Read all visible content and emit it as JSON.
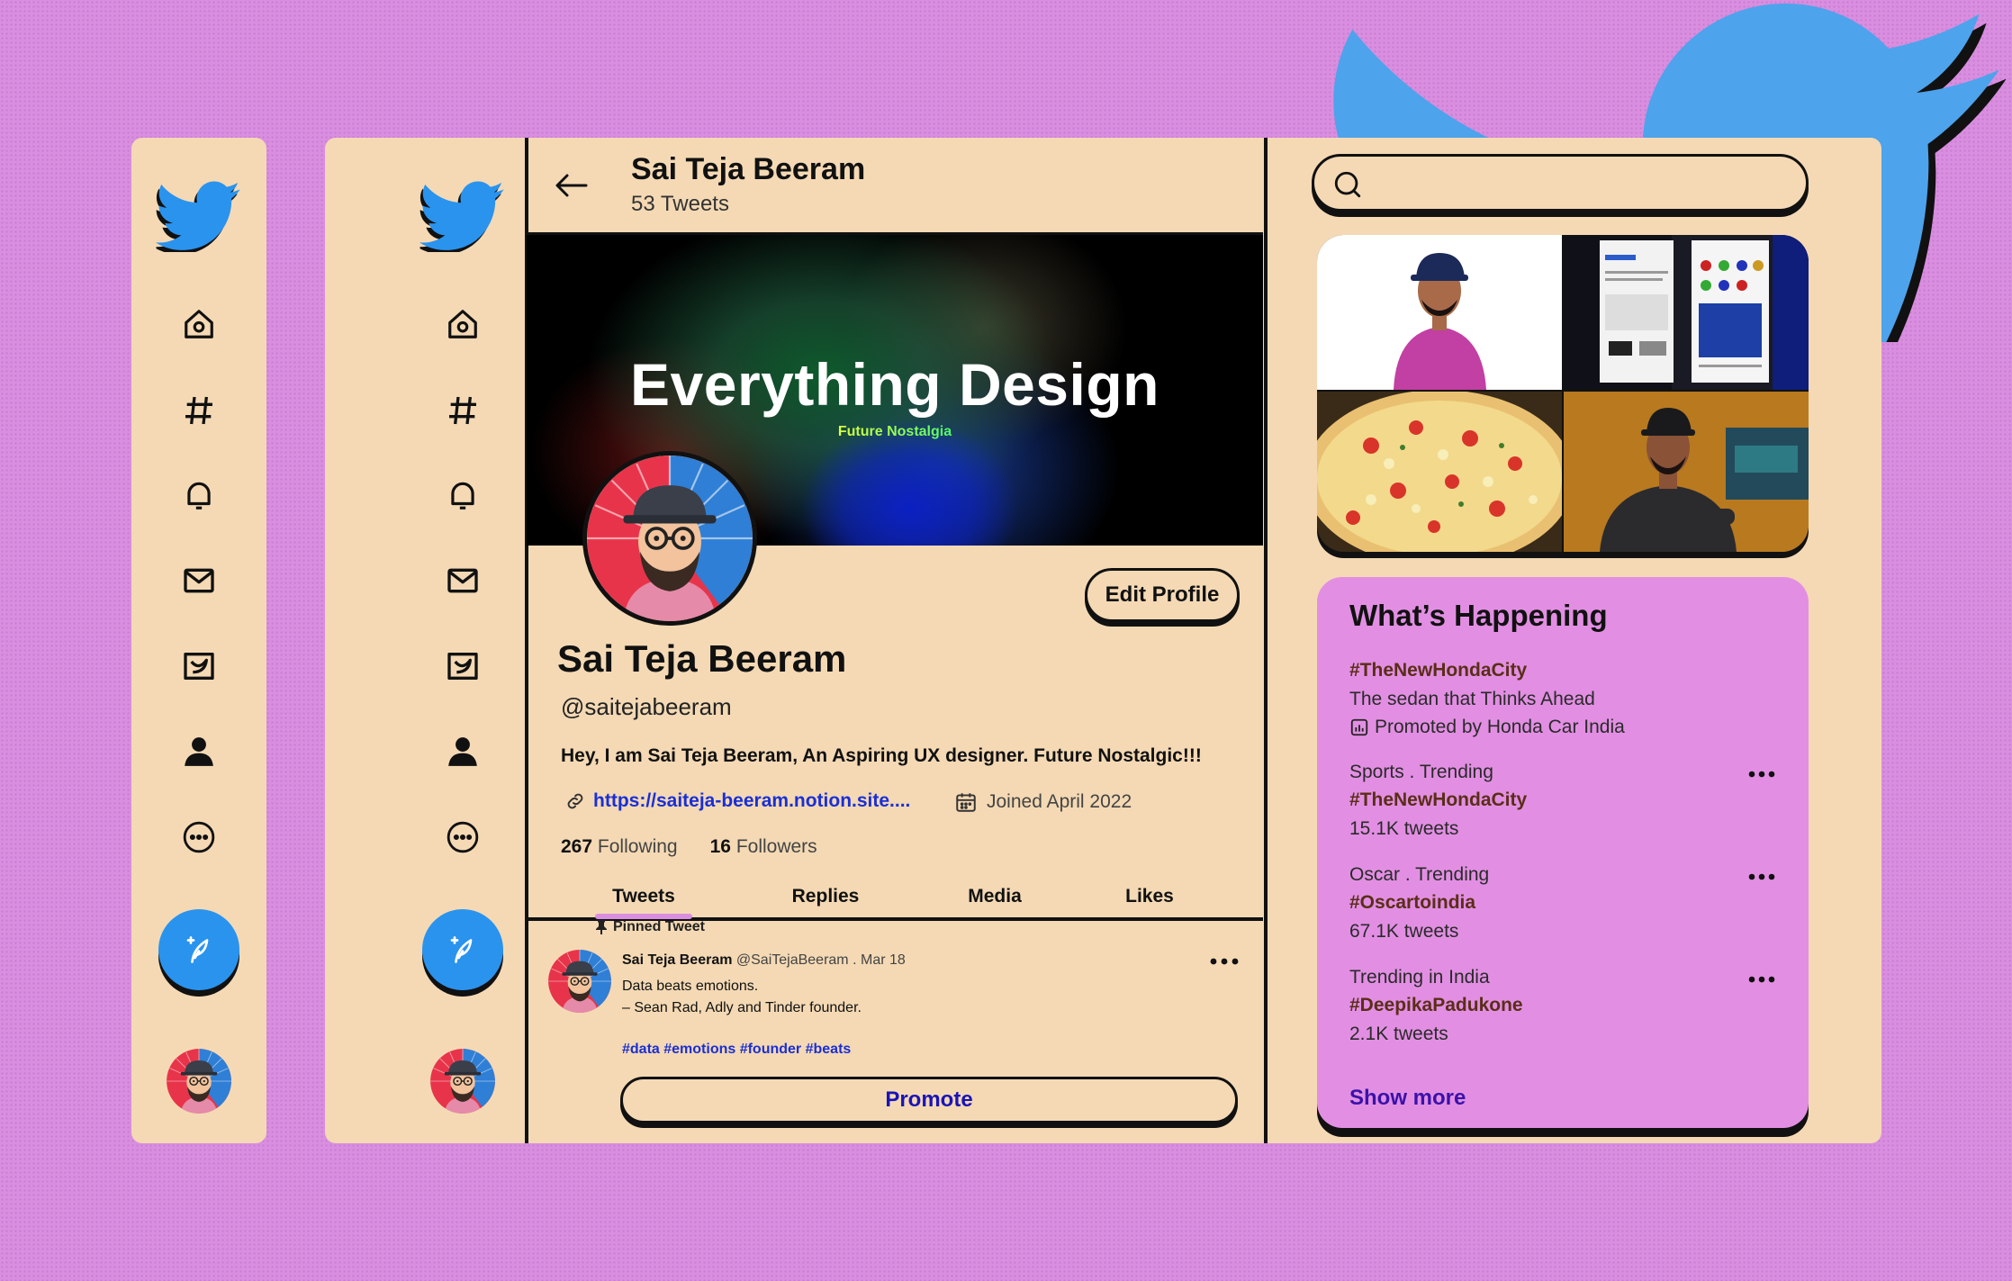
{
  "colors": {
    "card": "#f4d9b4",
    "twitter_blue": "#2a93ee",
    "accent_pink": "#e28fe3",
    "link": "#1a2fd6",
    "background": "#d98ee0"
  },
  "icons": [
    "twitter-bird-icon",
    "home-icon",
    "hashtag-icon",
    "bell-icon",
    "mail-icon",
    "bookmark-bird-icon",
    "profile-icon",
    "more-circle-icon",
    "compose-quill-icon",
    "back-arrow-icon",
    "search-icon",
    "link-icon",
    "calendar-icon",
    "pin-icon",
    "dots-icon",
    "promoted-icon"
  ],
  "header": {
    "name": "Sai Teja Beeram",
    "tweet_count": "53 Tweets"
  },
  "banner": {
    "title": "Everything Design",
    "subtitle": "Future Nostalgia"
  },
  "profile": {
    "edit_label": "Edit Profile",
    "name": "Sai Teja Beeram",
    "handle": "@saitejabeeram",
    "bio": "Hey, I am Sai Teja Beeram, An Aspiring UX designer. Future Nostalgic!!!",
    "link": "https://saiteja-beeram.notion.site....",
    "joined": "Joined April 2022",
    "following_count": "267",
    "following_label": "Following",
    "followers_count": "16",
    "followers_label": "Followers"
  },
  "tabs": [
    {
      "label": "Tweets",
      "active": true
    },
    {
      "label": "Replies",
      "active": false
    },
    {
      "label": "Media",
      "active": false
    },
    {
      "label": "Likes",
      "active": false
    }
  ],
  "tweet": {
    "pinned_label": "Pinned Tweet",
    "author": "Sai Teja Beeram",
    "handle": "@SaiTejaBeeram",
    "date": ". Mar 18",
    "line1": "Data beats emotions.",
    "line2": "– Sean Rad, Adly and Tinder founder.",
    "tags": "#data #emotions #founder #beats",
    "promote_label": "Promote"
  },
  "search": {
    "placeholder": ""
  },
  "happening": {
    "title": "What’s Happening",
    "promoted": {
      "tag": "#TheNewHondaCity",
      "text": "The sedan that Thinks Ahead",
      "by": "Promoted by Honda Car India"
    },
    "trends": [
      {
        "category": "Sports . Trending",
        "tag": "#TheNewHondaCity",
        "count": "15.1K tweets"
      },
      {
        "category": "Oscar . Trending",
        "tag": "#Oscartoindia",
        "count": "67.1K tweets"
      },
      {
        "category": "Trending in India",
        "tag": "#DeepikaPadukone",
        "count": "2.1K tweets"
      }
    ],
    "show_more": "Show more"
  }
}
